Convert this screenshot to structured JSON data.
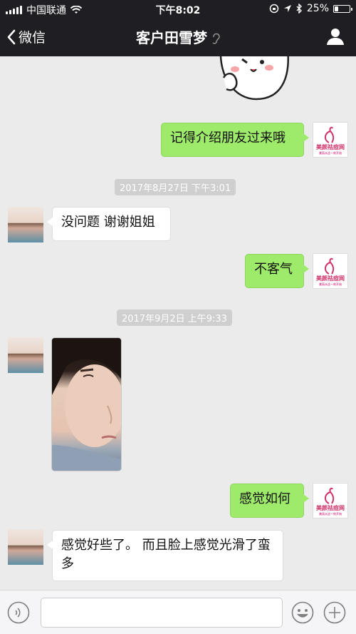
{
  "status_bar": {
    "carrier": "中国联通",
    "time": "下午8:02",
    "battery": "25%",
    "battery_level": 0.25
  },
  "nav": {
    "back_label": "微信",
    "title": "客户田雪梦"
  },
  "brand": {
    "name": "美颜祛痘网",
    "slogan": "美丽从这一刻开始"
  },
  "messages": {
    "m1": "记得介绍朋友过来哦",
    "t1": "2017年8月27日 下午3:01",
    "m2": "没问题 谢谢姐姐",
    "m3": "不客气",
    "t2": "2017年9月2日 上午9:33",
    "m4": "感觉如何",
    "m5": "感觉好些了。 而且脸上感觉光滑了蛮多"
  },
  "composer": {
    "placeholder": ""
  },
  "colors": {
    "sent_bubble": "#9eea6a",
    "received_bubble": "#ffffff",
    "nav_bg": "#1f1f23",
    "chat_bg": "#ebebeb"
  }
}
